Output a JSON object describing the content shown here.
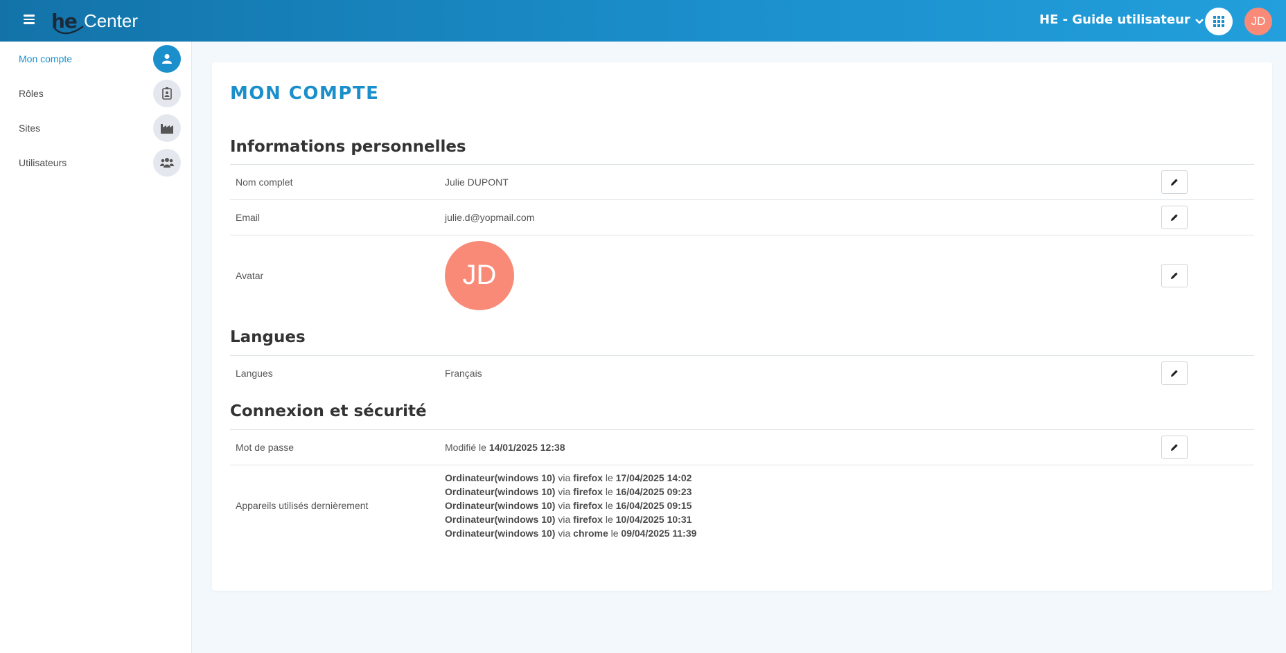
{
  "header": {
    "logo_text": "he",
    "app_name": "Center",
    "org_name": "HE - Guide utilisateur",
    "user_initials": "JD"
  },
  "sidebar": {
    "items": [
      {
        "label": "Mon compte",
        "icon": "user-icon",
        "active": true
      },
      {
        "label": "Rôles",
        "icon": "badge-icon",
        "active": false
      },
      {
        "label": "Sites",
        "icon": "factory-icon",
        "active": false
      },
      {
        "label": "Utilisateurs",
        "icon": "users-icon",
        "active": false
      }
    ]
  },
  "main": {
    "title": "MON COMPTE",
    "sections": {
      "personal": {
        "title": "Informations personnelles",
        "rows": [
          {
            "label": "Nom complet",
            "value": "Julie DUPONT"
          },
          {
            "label": "Email",
            "value": "julie.d@yopmail.com"
          },
          {
            "label": "Avatar",
            "value": "JD"
          }
        ]
      },
      "languages": {
        "title": "Langues",
        "rows": [
          {
            "label": "Langues",
            "value": "Français"
          }
        ]
      },
      "security": {
        "title": "Connexion et sécurité",
        "password": {
          "label": "Mot de passe",
          "prefix": "Modifié le",
          "date": "14/01/2025 12:38"
        },
        "devices": {
          "label": "Appareils utilisés dernièrement",
          "via_word": "via",
          "le_word": "le",
          "list": [
            {
              "device": "Ordinateur(windows 10)",
              "browser": "firefox",
              "date": "17/04/2025 14:02"
            },
            {
              "device": "Ordinateur(windows 10)",
              "browser": "firefox",
              "date": "16/04/2025 09:23"
            },
            {
              "device": "Ordinateur(windows 10)",
              "browser": "firefox",
              "date": "16/04/2025 09:15"
            },
            {
              "device": "Ordinateur(windows 10)",
              "browser": "firefox",
              "date": "10/04/2025 10:31"
            },
            {
              "device": "Ordinateur(windows 10)",
              "browser": "chrome",
              "date": "09/04/2025 11:39"
            }
          ]
        }
      }
    }
  },
  "colors": {
    "primary": "#1b8fcb",
    "avatar": "#fa8a78",
    "header_dark": "#1373a9"
  }
}
